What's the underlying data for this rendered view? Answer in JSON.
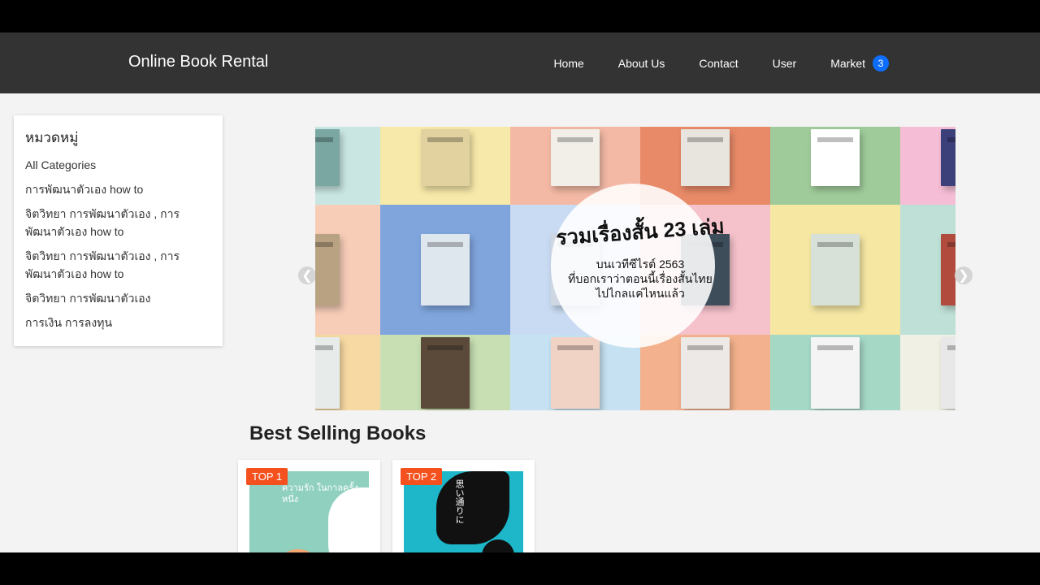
{
  "navbar": {
    "brand": "Online Book Rental",
    "links": [
      {
        "label": "Home"
      },
      {
        "label": "About Us"
      },
      {
        "label": "Contact"
      },
      {
        "label": "User"
      },
      {
        "label": "Market",
        "badge": "3"
      }
    ],
    "background": "#333333",
    "badge_color": "#0d6efd"
  },
  "sidebar": {
    "title": "หมวดหมู่",
    "items": [
      "All Categories",
      "การพัฒนาตัวเอง how to",
      "จิตวิทยา การพัฒนาตัวเอง , การพัฒนาตัวเอง how to",
      "จิตวิทยา การพัฒนาตัวเอง , การพัฒนาตัวเอง how to",
      "จิตวิทยา การพัฒนาตัวเอง",
      "การเงิน การลงทุน"
    ]
  },
  "carousel": {
    "title": "รวมเรื่องสั้น 23 เล่ม",
    "subtitle_lines": [
      "บนเวทีซีไรต์ 2563",
      "ที่บอกเราว่าตอนนี้เรื่องสั้นไทย",
      "ไปไกลแค่ไหนแล้ว"
    ],
    "prev_icon": "chevron-left-icon",
    "next_icon": "chevron-right-icon"
  },
  "best_selling": {
    "title": "Best Selling Books",
    "books": [
      {
        "rank": "TOP 1",
        "cover_text": "ความรัก ในกาลครั้งหนึ่ง"
      },
      {
        "rank": "TOP 2",
        "cover_text": "思い通りに"
      }
    ],
    "badge_color": "#f4511e"
  }
}
